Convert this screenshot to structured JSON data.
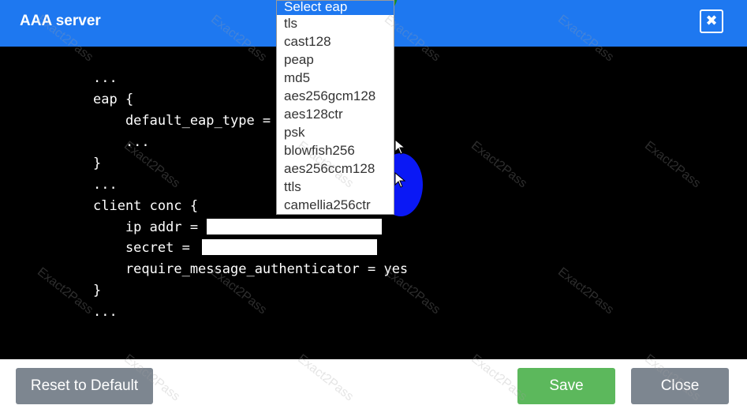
{
  "dialog": {
    "title": "AAA server",
    "close_icon_glyph": "✖"
  },
  "code": {
    "lines": [
      "...",
      "eap {",
      "    default_eap_type =",
      "    ...",
      "}",
      "...",
      "client conc {",
      "    ip addr =",
      "    secret =",
      "    require_message_authenticator = yes",
      "}",
      "..."
    ],
    "ip_addr_value": "",
    "secret_value": ""
  },
  "eap_dropdown": {
    "selected": "Select eap",
    "options": [
      "tls",
      "cast128",
      "peap",
      "md5",
      "aes256gcm128",
      "aes128ctr",
      "psk",
      "blowfish256",
      "aes256ccm128",
      "ttls",
      "camellia256ctr"
    ]
  },
  "footer": {
    "reset_label": "Reset to Default",
    "save_label": "Save",
    "close_label": "Close"
  },
  "watermark": "Exact2Pass",
  "colors": {
    "header": "#1e78f0",
    "editor_bg": "#000000",
    "save": "#5cb85c",
    "neutral_button": "#7d8690"
  }
}
